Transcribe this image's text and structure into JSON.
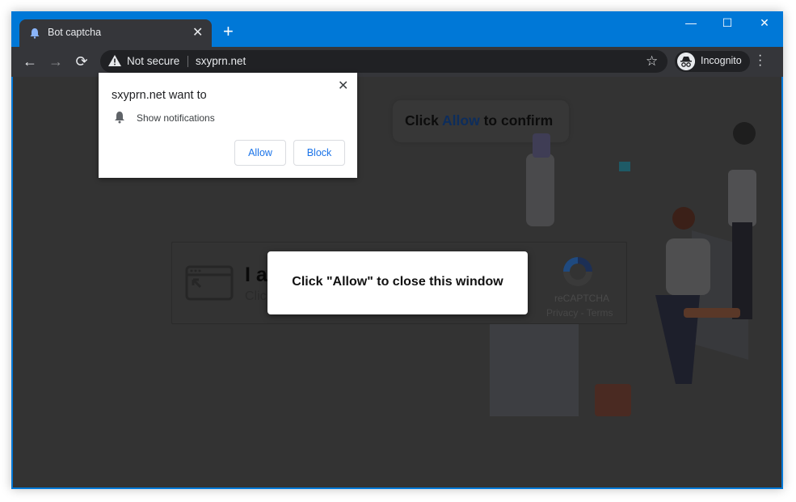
{
  "browser": {
    "tab": {
      "title": "Bot captcha",
      "icon": "bell-icon"
    },
    "new_tab": "+",
    "window_controls": {
      "minimize": "—",
      "maximize": "☐",
      "close": "✕"
    },
    "nav": {
      "back": "←",
      "forward": "→",
      "reload": "⟳"
    },
    "omnibox": {
      "security_label": "Not secure",
      "url": "sxyprn.net"
    },
    "bookmark_star": "☆",
    "profile_label": "Incognito",
    "menu": "⋮",
    "accent_color": "#0078d7"
  },
  "permission_popup": {
    "title": "sxyprn.net want to",
    "permission": "Show notifications",
    "close": "✕",
    "allow_label": "Allow",
    "block_label": "Block"
  },
  "page": {
    "confirm_banner": {
      "prefix": "Click ",
      "highlight": "Allow",
      "suffix": " to confirm"
    },
    "captcha": {
      "title": "I am not a robot",
      "subtitle": "Click Allow",
      "recaptcha_label": "reCAPTCHA",
      "recaptcha_links": "Privacy - Terms"
    },
    "modal": {
      "message": "Click \"Allow\" to close this window"
    }
  }
}
